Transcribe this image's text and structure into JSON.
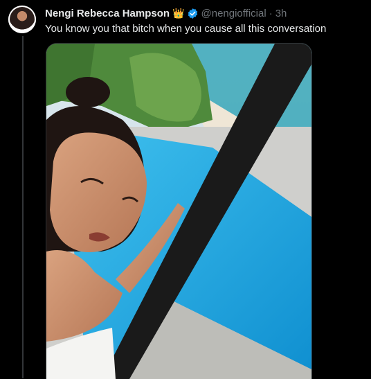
{
  "tweet": {
    "author_name": "Nengi Rebecca Hampson",
    "crown_emoji": "👑",
    "handle": "@nengiofficial",
    "separator": "·",
    "time": "3h",
    "text": "You know you that bitch when you cause all this conversation"
  },
  "media": {
    "alt": "Selfie photo beside a glass door overlooking a pool and beach"
  },
  "colors": {
    "background": "#000000",
    "text_primary": "#e7e9ea",
    "text_secondary": "#71767b",
    "verified_blue": "#1d9bf0",
    "border": "#2f3336"
  }
}
